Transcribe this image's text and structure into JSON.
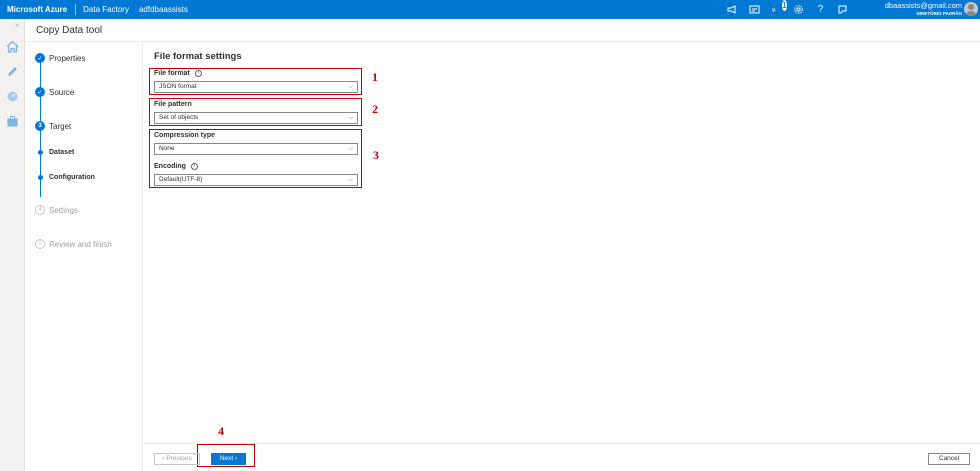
{
  "topbar": {
    "brand": "Microsoft Azure",
    "breadcrumb": [
      "Data Factory",
      "adfdbaassists"
    ],
    "notification_count": "1",
    "account_email": "dbaassists@gmail.com",
    "account_directory": "DIRETÓRIO PADRÃO"
  },
  "header": {
    "title": "Copy Data tool"
  },
  "steps": [
    {
      "label": "Properties",
      "state": "done",
      "icon": "check-icon"
    },
    {
      "label": "Source",
      "state": "done",
      "icon": "check-icon"
    },
    {
      "label": "Target",
      "state": "current",
      "number": "3"
    },
    {
      "label": "Dataset",
      "state": "done-sub"
    },
    {
      "label": "Configuration",
      "state": "current-sub"
    },
    {
      "label": "Settings",
      "state": "todo",
      "number": "4"
    },
    {
      "label": "Review and finish",
      "state": "todo",
      "number": "5"
    }
  ],
  "content": {
    "title": "File format settings",
    "file_format": {
      "label": "File format",
      "value": "JSON format"
    },
    "file_pattern": {
      "label": "File pattern",
      "value": "Set of objects"
    },
    "compression_type": {
      "label": "Compression type",
      "value": "None"
    },
    "encoding": {
      "label": "Encoding",
      "value": "Default(UTF-8)"
    }
  },
  "annotations": [
    "1",
    "2",
    "3",
    "4"
  ],
  "footer": {
    "previous_label": "Previous",
    "next_label": "Next",
    "cancel_label": "Cancel"
  },
  "colors": {
    "accent": "#0078d4",
    "annotation": "#c00000"
  }
}
